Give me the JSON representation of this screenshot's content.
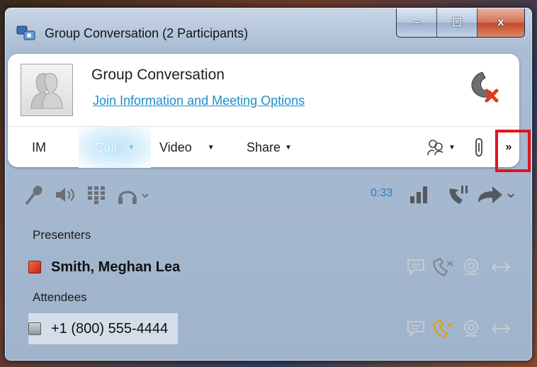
{
  "window": {
    "title": "Group Conversation (2 Participants)",
    "caption_buttons": {
      "minimize": "–",
      "maximize": "☐",
      "close": "x"
    }
  },
  "header": {
    "conversation_title": "Group Conversation",
    "join_link": "Join Information and Meeting Options"
  },
  "toolbar": {
    "im_label": "IM",
    "call_label": "Call",
    "video_label": "Video",
    "share_label": "Share",
    "more_label": "»",
    "dropdown_arrow": "▼"
  },
  "media": {
    "timer": "0:33"
  },
  "participants": {
    "presenters_label": "Presenters",
    "attendees_label": "Attendees",
    "presenters": [
      {
        "name": "Smith, Meghan Lea",
        "presence": "busy"
      }
    ],
    "attendees": [
      {
        "name": "+1 (800) 555-4444",
        "presence": "phone"
      }
    ]
  },
  "colors": {
    "link": "#1d8fc7",
    "timer": "#2a7fbf",
    "highlight": "#e0141e",
    "busy": "#e23a1e",
    "call_active_icon": "#d8a21c"
  },
  "icons": [
    "app-icon",
    "avatar-icon",
    "hangup-icon",
    "people-icon",
    "paperclip-icon",
    "microphone-icon",
    "speaker-icon",
    "dialpad-icon",
    "headset-icon",
    "signal-bars-icon",
    "hold-icon",
    "forward-arrow-icon",
    "im-icon",
    "call-icon",
    "video-icon",
    "transfer-icon"
  ]
}
